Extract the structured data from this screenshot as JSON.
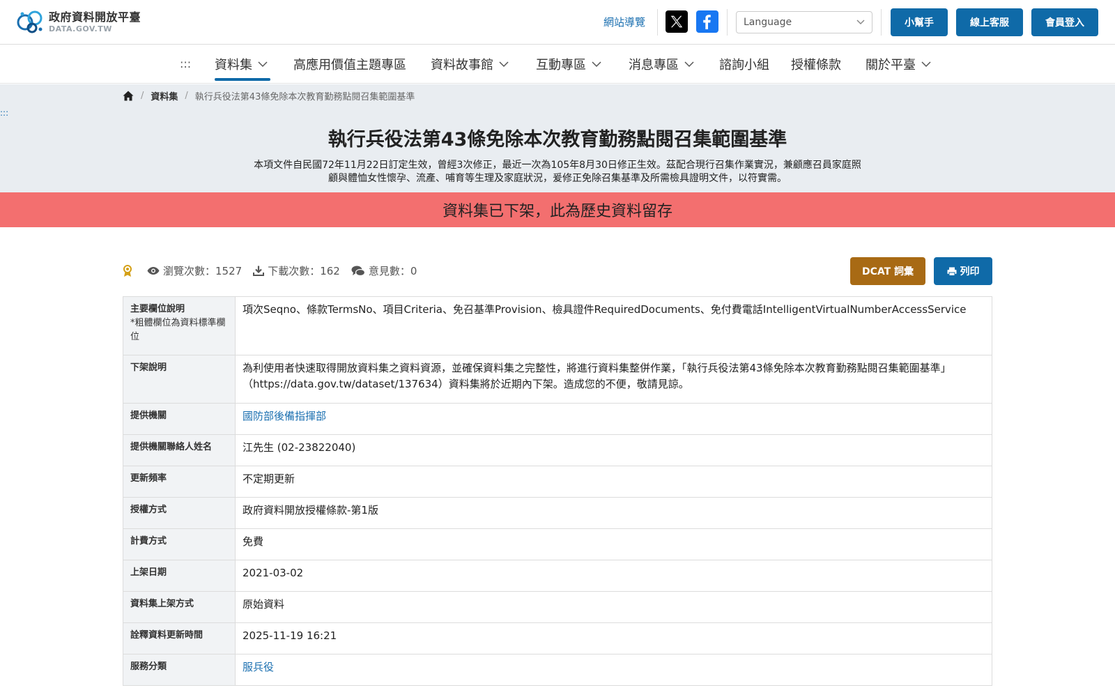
{
  "header": {
    "logo_zh": "政府資料開放平臺",
    "logo_en": "DATA.GOV.TW",
    "sitemap": "網站導覽",
    "language_placeholder": "Language",
    "buttons": [
      "小幫手",
      "線上客服",
      "會員登入"
    ]
  },
  "nav": {
    "dots": ":::",
    "items": [
      {
        "label": "資料集",
        "dropdown": true,
        "active": true
      },
      {
        "label": "高應用價值主題專區",
        "dropdown": false
      },
      {
        "label": "資料故事館",
        "dropdown": true
      },
      {
        "label": "互動專區",
        "dropdown": true
      },
      {
        "label": "消息專區",
        "dropdown": true
      },
      {
        "label": "諮詢小組",
        "dropdown": false
      },
      {
        "label": "授權條款",
        "dropdown": false
      },
      {
        "label": "關於平臺",
        "dropdown": true
      }
    ]
  },
  "breadcrumb": {
    "items": [
      "資料集",
      "執行兵役法第43條免除本次教育勤務點閱召集範圍基準"
    ]
  },
  "side_dots": ":::",
  "page": {
    "title": "執行兵役法第43條免除本次教育勤務點閱召集範圍基準",
    "description": "本項文件自民國72年11月22日訂定生效，曾經3次修正，最近一次為105年8月30日修正生效。茲配合現行召集作業實況，兼顧應召員家庭照顧與體恤女性懷孕、流產、哺育等生理及家庭狀況，爰修正免除召集基準及所需檢具證明文件，以符實需。",
    "alert": "資料集已下架，此為歷史資料留存"
  },
  "stats": {
    "views_label": "瀏覽次數：",
    "views": "1527",
    "downloads_label": "下載次數：",
    "downloads": "162",
    "comments_label": "意見數：",
    "comments": "0"
  },
  "actions": {
    "dcat": "DCAT 詞彙",
    "print": "列印"
  },
  "details": {
    "rows": [
      {
        "label": "主要欄位說明",
        "sub": "*粗體欄位為資料標準欄位",
        "value": "項次Seqno、條款TermsNo、項目Criteria、免召基準Provision、檢具證件RequiredDocuments、免付費電話IntelligentVirtualNumberAccessService"
      },
      {
        "label": "下架說明",
        "value": "為利使用者快速取得開放資料集之資料資源，並確保資料集之完整性，將進行資料集整併作業，「執行兵役法第43條免除本次教育勤務點閱召集範圍基準」（https://data.gov.tw/dataset/137634）資料集將於近期內下架。造成您的不便，敬請見諒。"
      },
      {
        "label": "提供機關",
        "value": "國防部後備指揮部",
        "link": true
      },
      {
        "label": "提供機關聯絡人姓名",
        "value": "江先生 (02-23822040)"
      },
      {
        "label": "更新頻率",
        "value": "不定期更新"
      },
      {
        "label": "授權方式",
        "value": "政府資料開放授權條款-第1版"
      },
      {
        "label": "計費方式",
        "value": "免費"
      },
      {
        "label": "上架日期",
        "value": "2021-03-02"
      },
      {
        "label": "資料集上架方式",
        "value": "原始資料"
      },
      {
        "label": "詮釋資料更新時間",
        "value": "2025-11-19 16:21"
      },
      {
        "label": "服務分類",
        "value": "服兵役",
        "link": true
      }
    ]
  },
  "colors": {
    "primary": "#0f6aa8",
    "alert": "#f36f6f",
    "dcat": "#a86a14",
    "banner_bg": "#e9edf1"
  }
}
